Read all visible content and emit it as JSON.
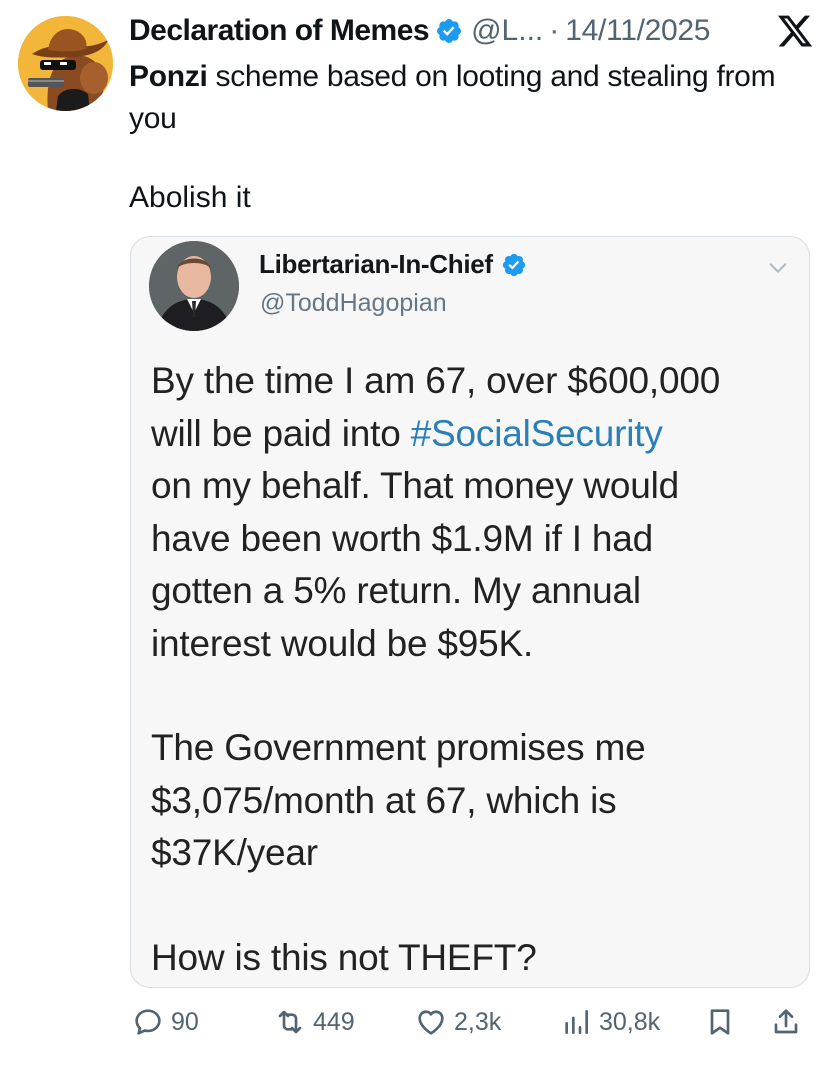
{
  "tweet": {
    "display_name": "Declaration of Memes",
    "handle": "@L...",
    "separator": "·",
    "date": "14/11/2025",
    "text_bold": "Ponzi",
    "text_rest": " scheme based on looting and stealing from you",
    "text_para2": "Abolish it"
  },
  "quoted": {
    "display_name": "Libertarian-In-Chief",
    "handle": "@ToddHagopian",
    "line1": "By the time I am 67, over $600,000",
    "line2_pre": "will be paid into ",
    "line2_hashtag": "#SocialSecurity",
    "line3": "on my behalf.  That money would",
    "line4": "have been worth $1.9M if I had",
    "line5": "gotten a 5% return. My annual",
    "line6": "interest would be $95K.",
    "line7": "The Government promises me",
    "line8": "$3,075/month at 67, which is",
    "line9": "$37K/year",
    "line10": "How is this not THEFT?"
  },
  "actions": {
    "replies": "90",
    "reposts": "449",
    "likes": "2,3k",
    "views": "30,8k"
  },
  "icons": [
    "verified-icon",
    "x-logo-icon",
    "chevron-down-icon",
    "reply-icon",
    "repost-icon",
    "like-icon",
    "views-icon",
    "bookmark-icon",
    "share-icon"
  ],
  "colors": {
    "verified_blue": "#1d9bf0",
    "hashtag": "#2a7fb8",
    "secondary_text": "#536471"
  }
}
